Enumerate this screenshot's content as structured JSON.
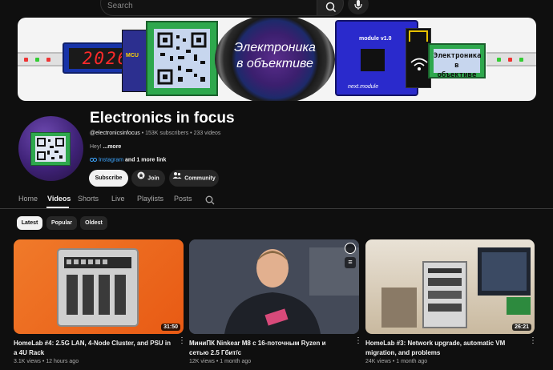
{
  "search": {
    "placeholder": "Search"
  },
  "banner": {
    "seg_display": "2026",
    "mcu_label": "MCU",
    "lens_text_line1": "Электроника",
    "lens_text_line2": "в объективе",
    "module_label": "module v1.0",
    "module_brand": "next.module",
    "lcd_line1": "Электроника",
    "lcd_line2": "в объективе"
  },
  "channel": {
    "title": "Electronics in focus",
    "handle": "@electronicsinfocus",
    "subscribers": "153K subscribers",
    "video_count": "233 videos",
    "desc_prefix": "Hey!",
    "more": "...more",
    "link_label": "Instagram",
    "more_links": "and 1 more link",
    "subscribe_label": "Subscribe",
    "join_label": "Join",
    "community_label": "Community"
  },
  "tabs": [
    "Home",
    "Videos",
    "Shorts",
    "Live",
    "Playlists",
    "Posts"
  ],
  "filters": {
    "latest": "Latest",
    "popular": "Popular",
    "oldest": "Oldest"
  },
  "videos": [
    {
      "title_l1": "HomeLab #4: 2.5G LAN, 4-Node Cluster, and PSU in",
      "title_l2": "a 4U Rack",
      "duration": "31:50",
      "views": "3.1K views",
      "age": "12 hours ago"
    },
    {
      "title_l1": "МиниПК Ninkear M8 с 16-поточным Ryzen и",
      "title_l2": "сетью 2.5 Гбит/с",
      "duration": "",
      "views": "12K views",
      "age": "1 month ago"
    },
    {
      "title_l1": "HomeLab #3: Network upgrade, automatic VM",
      "title_l2": "migration, and problems",
      "duration": "26:21",
      "views": "24K views",
      "age": "1 month ago"
    }
  ],
  "colors": {
    "accent_link": "#3ea6ff",
    "background": "#0f0f0f"
  }
}
